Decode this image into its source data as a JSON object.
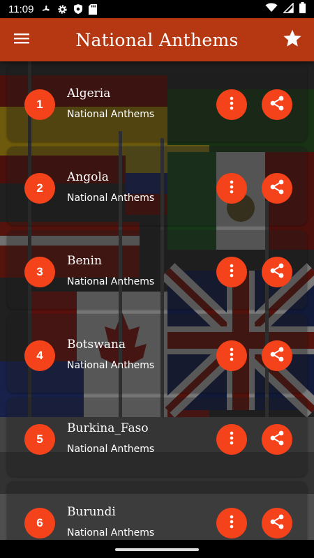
{
  "status_bar": {
    "time": "11:09",
    "left_icons": [
      "fan-icon",
      "settings-icon",
      "shield-icon",
      "sd-card-icon"
    ],
    "right_icons": [
      "wifi-icon",
      "signal-icon",
      "battery-icon"
    ]
  },
  "app_bar": {
    "title": "National Anthems",
    "menu_icon": "hamburger-menu-icon",
    "favorite_icon": "star-icon"
  },
  "colors": {
    "app_bar": "#b53812",
    "accent": "#f4431b"
  },
  "anthems": [
    {
      "number": "1",
      "country": "Algeria",
      "subtitle": "National Anthems"
    },
    {
      "number": "2",
      "country": "Angola",
      "subtitle": "National Anthems"
    },
    {
      "number": "3",
      "country": "Benin",
      "subtitle": "National Anthems"
    },
    {
      "number": "4",
      "country": "Botswana",
      "subtitle": "National Anthems"
    },
    {
      "number": "5",
      "country": "Burkina_Faso",
      "subtitle": "National Anthems"
    },
    {
      "number": "6",
      "country": "Burundi",
      "subtitle": "National Anthems"
    }
  ],
  "item_icons": {
    "more": "more-vertical-icon",
    "share": "share-icon"
  }
}
